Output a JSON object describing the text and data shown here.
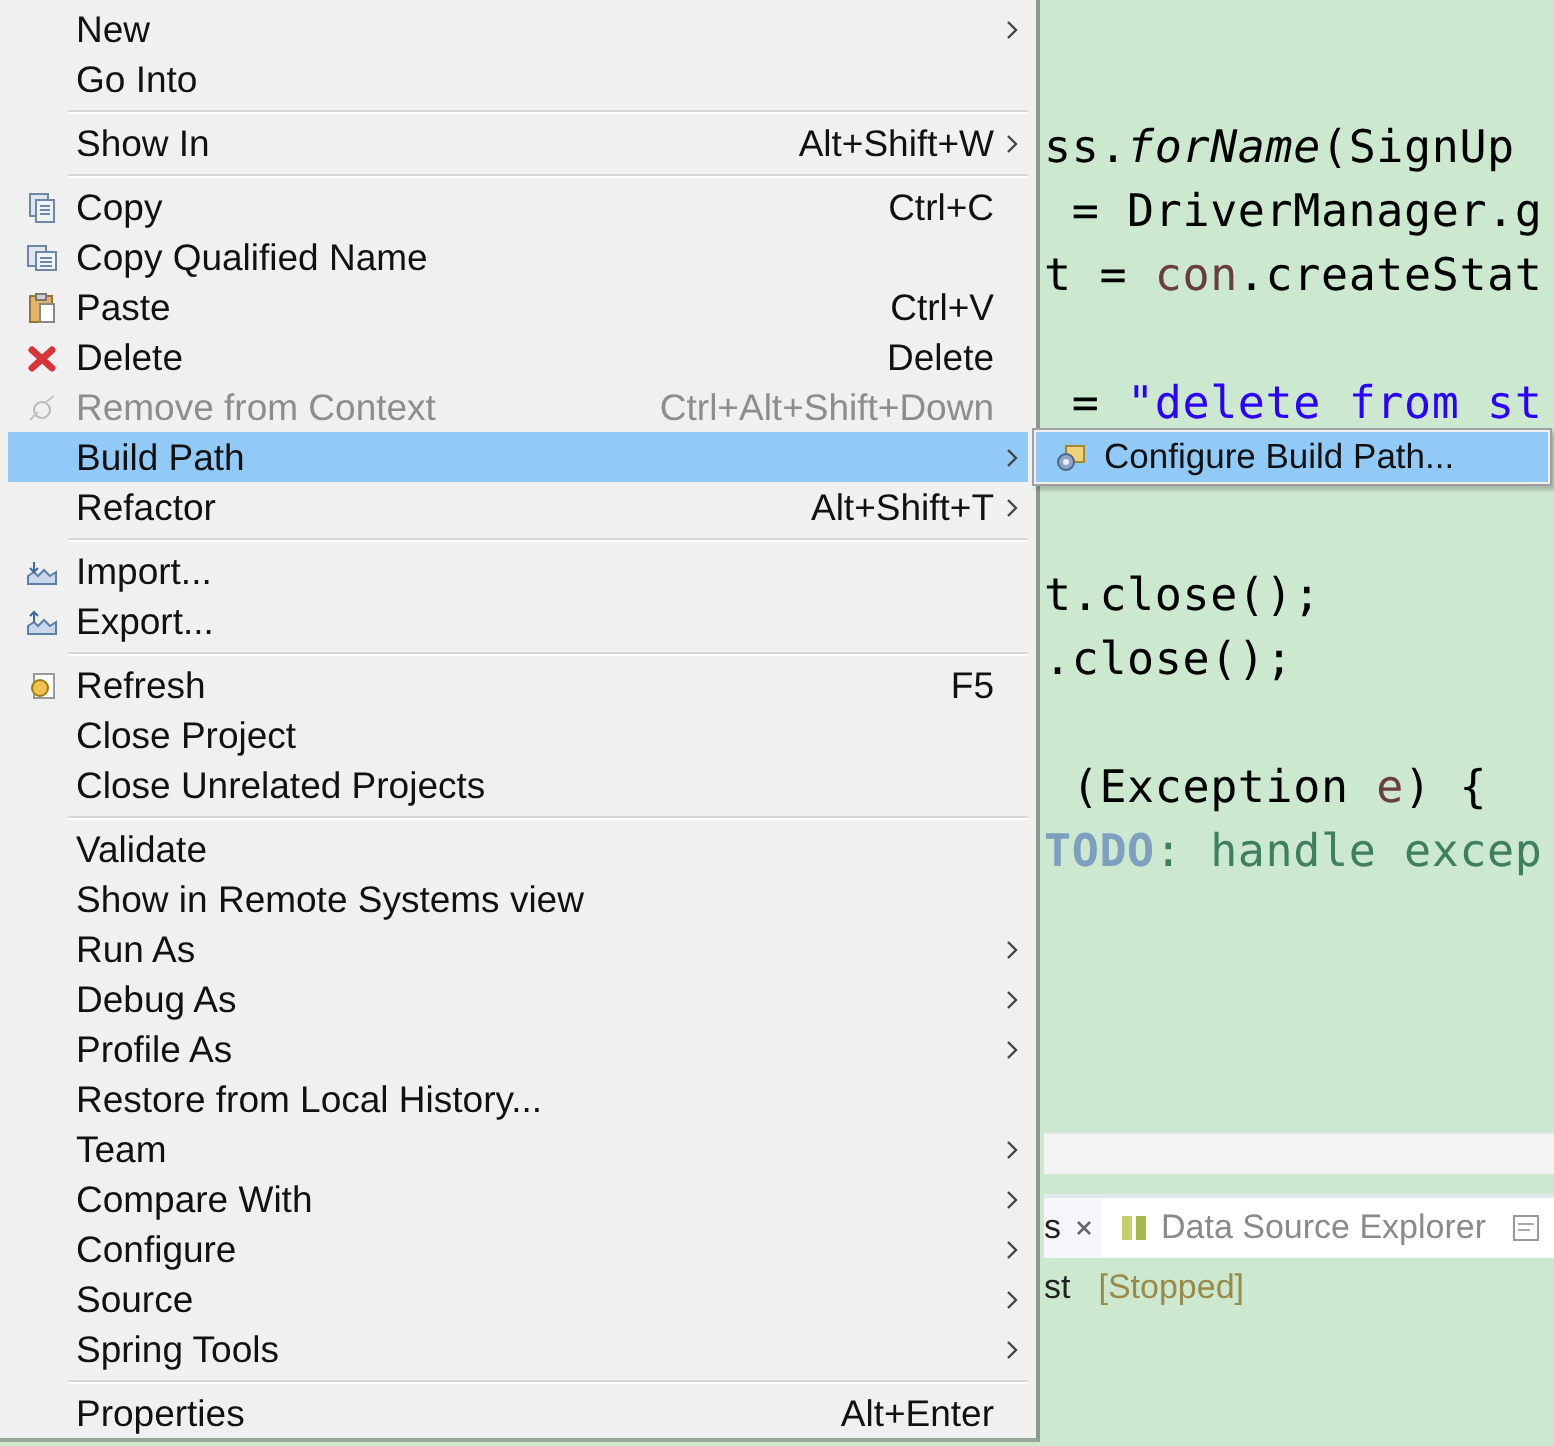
{
  "editor": {
    "code_lines": [
      {
        "kind": "code",
        "tokens": [
          {
            "text": "ss.",
            "kind": "plain"
          },
          {
            "text": "forName",
            "kind": "italic"
          },
          {
            "text": "(SignUp",
            "kind": "plain"
          }
        ]
      },
      {
        "kind": "code",
        "tokens": [
          {
            "text": " = DriverManager.g",
            "kind": "plain"
          }
        ]
      },
      {
        "kind": "code",
        "tokens": [
          {
            "text": "t = ",
            "kind": "plain"
          },
          {
            "text": "con",
            "kind": "variable"
          },
          {
            "text": ".createStat",
            "kind": "plain"
          }
        ]
      },
      {
        "kind": "blank"
      },
      {
        "kind": "code",
        "tokens": [
          {
            "text": " = ",
            "kind": "plain"
          },
          {
            "text": "\"delete from st",
            "kind": "string"
          }
        ]
      },
      {
        "kind": "blank"
      },
      {
        "kind": "blank"
      },
      {
        "kind": "code",
        "tokens": [
          {
            "text": "t.close();",
            "kind": "plain"
          }
        ]
      },
      {
        "kind": "code",
        "tokens": [
          {
            "text": ".close();",
            "kind": "plain"
          }
        ]
      },
      {
        "kind": "blank"
      },
      {
        "kind": "code",
        "tokens": [
          {
            "text": " (Exception ",
            "kind": "plain"
          },
          {
            "text": "e",
            "kind": "variable"
          },
          {
            "text": ") {",
            "kind": "plain"
          }
        ]
      },
      {
        "kind": "code",
        "tokens": [
          {
            "text": "TODO",
            "kind": "todo"
          },
          {
            "text": ": handle excep",
            "kind": "comment"
          }
        ]
      }
    ]
  },
  "bottom_panel": {
    "tabs": [
      {
        "label": "s",
        "selected": true
      },
      {
        "label": "Data Source Explorer",
        "selected": false
      }
    ],
    "console_name": "st",
    "console_status": "[Stopped]"
  },
  "context_menu": {
    "items": [
      {
        "kind": "item",
        "label": "New",
        "submenu": true
      },
      {
        "kind": "item",
        "label": "Go Into"
      },
      {
        "kind": "separator"
      },
      {
        "kind": "item",
        "label": "Show In",
        "shortcut": "Alt+Shift+W",
        "submenu": true
      },
      {
        "kind": "separator"
      },
      {
        "kind": "copy",
        "label": "Copy",
        "shortcut": "Ctrl+C"
      },
      {
        "kind": "copy-name",
        "label": "Copy Qualified Name"
      },
      {
        "kind": "paste",
        "label": "Paste",
        "shortcut": "Ctrl+V"
      },
      {
        "kind": "delete",
        "label": "Delete",
        "shortcut": "Delete"
      },
      {
        "kind": "remove",
        "label": "Remove from Context",
        "shortcut": "Ctrl+Alt+Shift+Down",
        "disabled": true
      },
      {
        "kind": "item",
        "label": "Build Path",
        "submenu": true,
        "selected": true
      },
      {
        "kind": "item",
        "label": "Refactor",
        "shortcut": "Alt+Shift+T",
        "submenu": true
      },
      {
        "kind": "separator"
      },
      {
        "kind": "import",
        "label": "Import..."
      },
      {
        "kind": "export",
        "label": "Export..."
      },
      {
        "kind": "separator"
      },
      {
        "kind": "refresh",
        "label": "Refresh",
        "shortcut": "F5"
      },
      {
        "kind": "item",
        "label": "Close Project"
      },
      {
        "kind": "item",
        "label": "Close Unrelated Projects"
      },
      {
        "kind": "separator"
      },
      {
        "kind": "item",
        "label": "Validate"
      },
      {
        "kind": "item",
        "label": "Show in Remote Systems view"
      },
      {
        "kind": "item",
        "label": "Run As",
        "submenu": true
      },
      {
        "kind": "item",
        "label": "Debug As",
        "submenu": true
      },
      {
        "kind": "item",
        "label": "Profile As",
        "submenu": true
      },
      {
        "kind": "item",
        "label": "Restore from Local History..."
      },
      {
        "kind": "item",
        "label": "Team",
        "submenu": true
      },
      {
        "kind": "item",
        "label": "Compare With",
        "submenu": true
      },
      {
        "kind": "item",
        "label": "Configure",
        "submenu": true
      },
      {
        "kind": "item",
        "label": "Source",
        "submenu": true
      },
      {
        "kind": "item",
        "label": "Spring Tools",
        "submenu": true
      },
      {
        "kind": "separator"
      },
      {
        "kind": "item",
        "label": "Properties",
        "shortcut": "Alt+Enter"
      }
    ]
  },
  "submenu": {
    "items": [
      {
        "kind": "build-path",
        "label": "Configure Build Path...",
        "selected": true
      }
    ]
  }
}
